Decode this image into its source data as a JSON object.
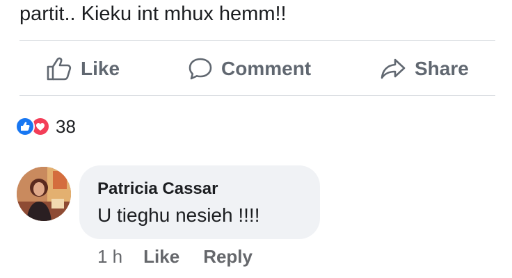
{
  "post": {
    "text": "partit.. Kieku int mhux hemm!!"
  },
  "actions": {
    "like_label": "Like",
    "comment_label": "Comment",
    "share_label": "Share"
  },
  "reactions": {
    "count": "38",
    "types": [
      "like",
      "love"
    ],
    "colors": {
      "like": "#1877f2",
      "love": "#f33e58"
    }
  },
  "comment": {
    "author": "Patricia Cassar",
    "text": "U tieghu nesieh !!!!",
    "time": "1 h",
    "like_label": "Like",
    "reply_label": "Reply"
  }
}
